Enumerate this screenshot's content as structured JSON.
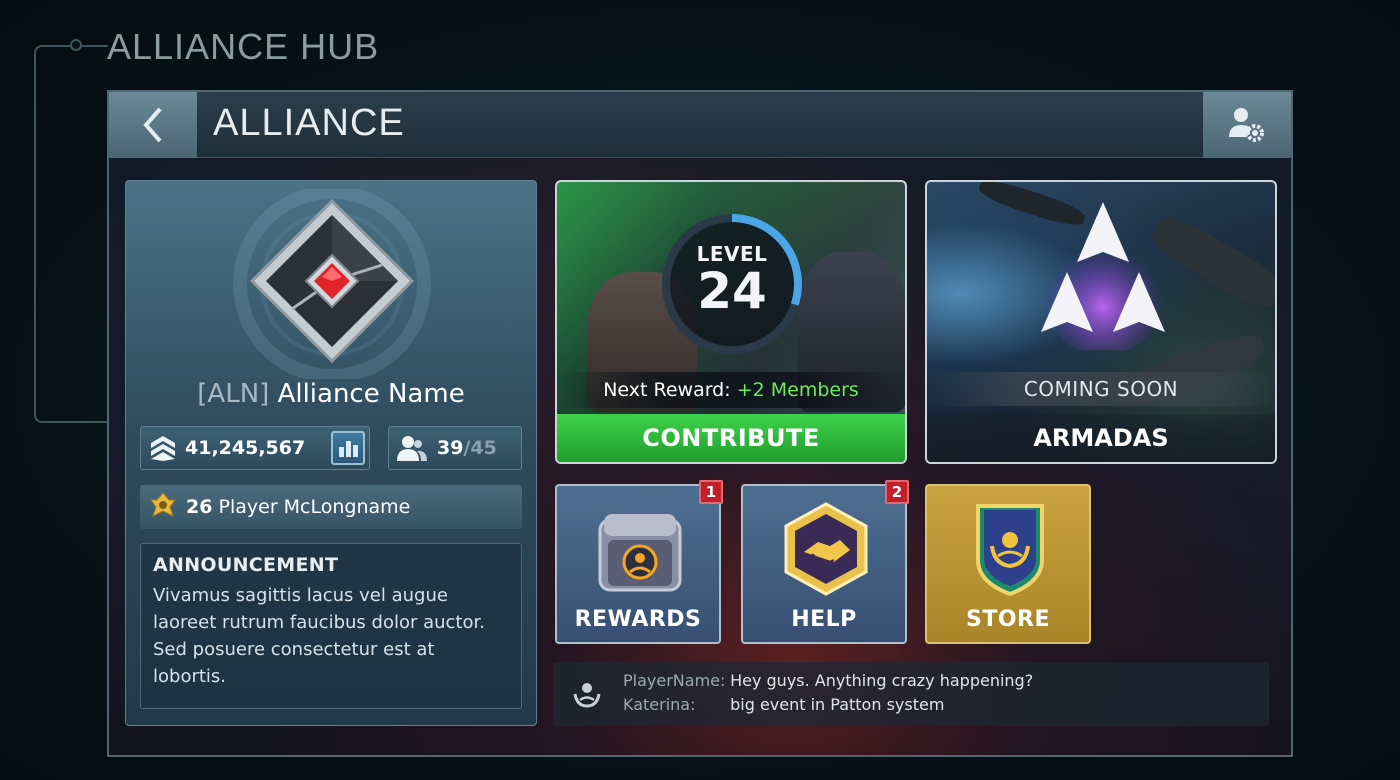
{
  "page_heading": "ALLIANCE HUB",
  "topbar": {
    "title": "ALLIANCE"
  },
  "alliance": {
    "tag": "[ALN]",
    "name": "Alliance Name",
    "power": "41,245,567",
    "members_current": "39",
    "members_max": "/45",
    "leader_level": "26",
    "leader_name": "Player McLongname"
  },
  "announcement": {
    "title": "ANNOUNCEMENT",
    "body": "Vivamus sagittis lacus vel augue laoreet rutrum faucibus dolor auctor. Sed posuere consectetur est at lobortis."
  },
  "contribute": {
    "level_label": "LEVEL",
    "level": "24",
    "level_progress": 0.3,
    "next_reward_label": "Next Reward:",
    "next_reward_value": "+2 Members",
    "button_label": "CONTRIBUTE"
  },
  "armadas": {
    "status": "COMING SOON",
    "label": "ARMADAS"
  },
  "tiles": {
    "rewards": {
      "label": "REWARDS",
      "badge": "1"
    },
    "help": {
      "label": "HELP",
      "badge": "2"
    },
    "store": {
      "label": "STORE"
    }
  },
  "chat": {
    "messages": [
      {
        "author": "PlayerName:",
        "text": "Hey guys. Anything crazy happening?"
      },
      {
        "author": "Katerina:",
        "text": "big event in Patton system"
      }
    ]
  },
  "icons": {
    "back": "chevron-left-icon",
    "settings": "user-gear-icon",
    "power": "power-chevron-icon",
    "chart": "bar-chart-icon",
    "members": "users-icon",
    "leader": "rank-insignia-icon"
  },
  "colors": {
    "accent_green": "#3fd24a",
    "reward_green": "#6ee85d",
    "badge_red": "#c21f2a",
    "store_gold": "#c9a33e"
  }
}
